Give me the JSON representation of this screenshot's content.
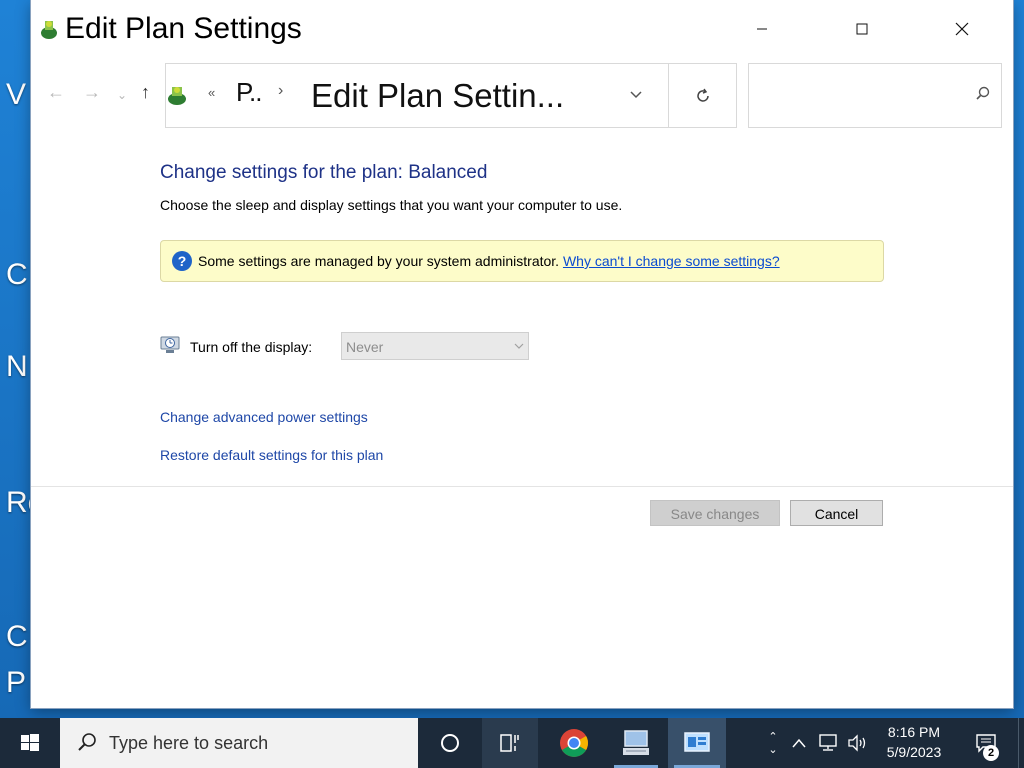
{
  "window": {
    "title": "Edit Plan Settings"
  },
  "address": {
    "prefix": "«",
    "ellipsis": "P..",
    "location": "Edit Plan Settin..."
  },
  "content": {
    "heading": "Change settings for the plan: Balanced",
    "subheading": "Choose the sleep and display settings that you want your computer to use.",
    "info": {
      "text": "Some settings are managed by your system administrator.",
      "link": "Why can't I change some settings?"
    },
    "setting": {
      "label": "Turn off the display:",
      "value": "Never"
    },
    "links": {
      "advanced": "Change advanced power settings",
      "restore": "Restore default settings for this plan"
    },
    "buttons": {
      "save": "Save changes",
      "cancel": "Cancel"
    }
  },
  "taskbar": {
    "search_placeholder": "Type here to search",
    "time": "8:16 PM",
    "date": "5/9/2023",
    "notification_count": "2"
  },
  "desktop_fragments": [
    "V",
    "C",
    "N",
    "Re",
    "C",
    "P"
  ],
  "colors": {
    "heading": "#1e3287",
    "link": "#1e47a7",
    "info_bg": "#fdfcc9",
    "taskbar": "#1c2a3a"
  }
}
